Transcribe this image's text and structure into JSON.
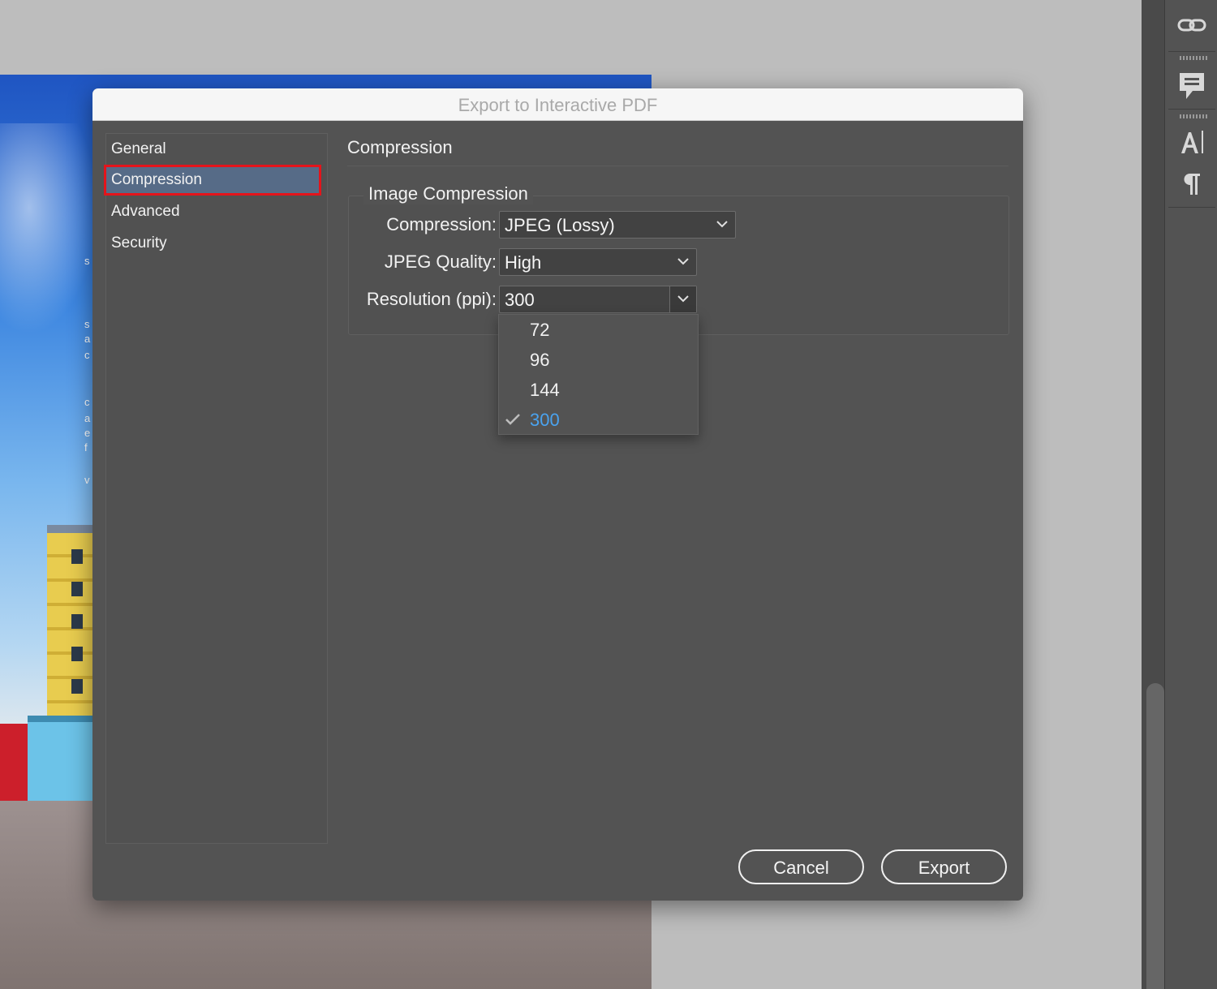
{
  "dialog": {
    "title": "Export to Interactive PDF",
    "sidebar": [
      {
        "label": "General",
        "selected": false
      },
      {
        "label": "Compression",
        "selected": true
      },
      {
        "label": "Advanced",
        "selected": false
      },
      {
        "label": "Security",
        "selected": false
      }
    ],
    "section_title": "Compression",
    "group_title": "Image Compression",
    "fields": {
      "compression": {
        "label": "Compression:",
        "value": "JPEG (Lossy)"
      },
      "jpeg_quality": {
        "label": "JPEG Quality:",
        "value": "High"
      },
      "resolution": {
        "label": "Resolution (ppi):",
        "value": "300"
      }
    },
    "resolution_options": [
      {
        "label": "72",
        "checked": false
      },
      {
        "label": "96",
        "checked": false
      },
      {
        "label": "144",
        "checked": false
      },
      {
        "label": "300",
        "checked": true
      }
    ],
    "buttons": {
      "cancel": "Cancel",
      "export": "Export"
    }
  },
  "right_panel_icons": [
    "links-icon",
    "comment-icon",
    "character-styles-icon",
    "paragraph-icon"
  ],
  "document_fragments": [
    "s",
    "s",
    "a",
    "c",
    "c",
    "a",
    "e",
    "f",
    "v"
  ],
  "colors": {
    "selection_highlight": "#566b87",
    "annotation_border": "#e4141b",
    "checked_item": "#4aa3ef",
    "dialog_bg": "#535353"
  }
}
